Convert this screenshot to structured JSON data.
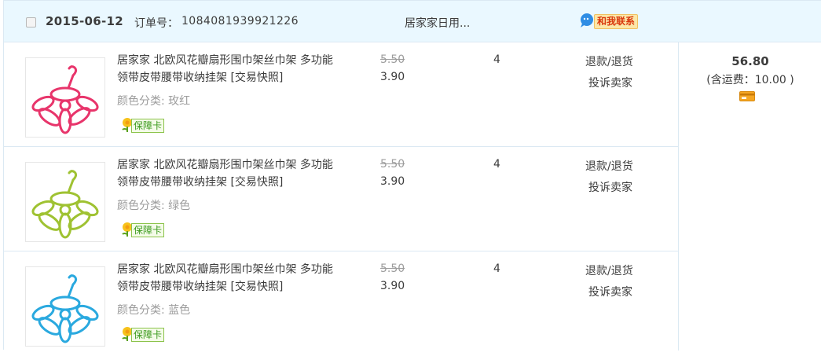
{
  "order": {
    "date": "2015-06-12",
    "order_no_label": "订单号：",
    "order_no": "1084081939921226",
    "shop": "居家家日用...",
    "contact_label": "和我联系",
    "total": "56.80",
    "shipping": "(含运费：10.00 )",
    "colors": {
      "header_bg": "#eaf8ff",
      "border": "#dbe9f3",
      "contact_text": "#d9370d",
      "badge_text": "#3a9a1c"
    }
  },
  "items": [
    {
      "title": "居家家 北欧风花瓣扇形围巾架丝巾架 多功能领带皮带腰带收纳挂架 [交易快照]",
      "sku": "颜色分类: 玫红",
      "badge": "保障卡",
      "original_price": "5.50",
      "price": "3.90",
      "quantity": "4",
      "refund": "退款/退货",
      "complain": "投诉卖家",
      "color": "#e8356b"
    },
    {
      "title": "居家家 北欧风花瓣扇形围巾架丝巾架 多功能领带皮带腰带收纳挂架 [交易快照]",
      "sku": "颜色分类: 绿色",
      "badge": "保障卡",
      "original_price": "5.50",
      "price": "3.90",
      "quantity": "4",
      "refund": "退款/退货",
      "complain": "投诉卖家",
      "color": "#9fc232"
    },
    {
      "title": "居家家 北欧风花瓣扇形围巾架丝巾架 多功能领带皮带腰带收纳挂架 [交易快照]",
      "sku": "颜色分类: 蓝色",
      "badge": "保障卡",
      "original_price": "5.50",
      "price": "3.90",
      "quantity": "4",
      "refund": "退款/退货",
      "complain": "投诉卖家",
      "color": "#2aa9df"
    }
  ]
}
